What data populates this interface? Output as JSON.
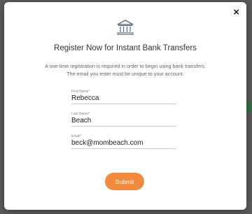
{
  "modal": {
    "close_label": "×",
    "title": "Register Now for Instant Bank Transfers",
    "description_line1": "A one-time registration is required in order to begin using bank transfers.",
    "description_line2": "The email you enter must be unique to your account.",
    "icon": "bank-icon"
  },
  "form": {
    "first_name": {
      "label": "First Name*",
      "value": "Rebecca"
    },
    "last_name": {
      "label": "Last Name*",
      "value": "Beach"
    },
    "email": {
      "label": "Email*",
      "value": "beck@mombeach.com"
    },
    "submit_label": "Submit"
  },
  "colors": {
    "accent": "#f18a3d",
    "overlay": "#5b5b5b"
  }
}
